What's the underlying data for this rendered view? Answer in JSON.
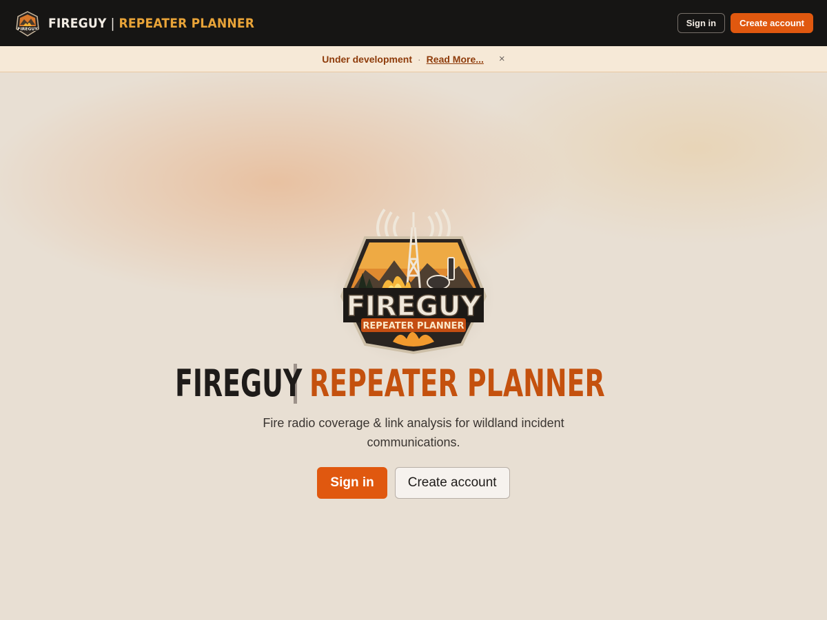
{
  "header": {
    "brand_name": "FIREGUY",
    "brand_separator": "|",
    "brand_sub": "REPEATER PLANNER",
    "sign_in_label": "Sign in",
    "create_account_label": "Create account"
  },
  "banner": {
    "status": "Under development",
    "dot": "·",
    "link": "Read More...",
    "close": "×"
  },
  "hero": {
    "logo_text_top": "FIREGUY",
    "logo_text_bottom": "REPEATER PLANNER",
    "title_main": "FIREGUY",
    "title_accent": "REPEATER PLANNER",
    "description": "Fire radio coverage & link analysis for wildland incident communications.",
    "sign_in_label": "Sign in",
    "create_account_label": "Create account"
  },
  "colors": {
    "accent": "#e0580f",
    "accent_dark": "#c4510e",
    "gold": "#e8a338",
    "topbar": "#161514",
    "background": "#e8dfd3"
  },
  "icons": {
    "logo": "fireguy-badge-icon",
    "close": "close-icon"
  }
}
